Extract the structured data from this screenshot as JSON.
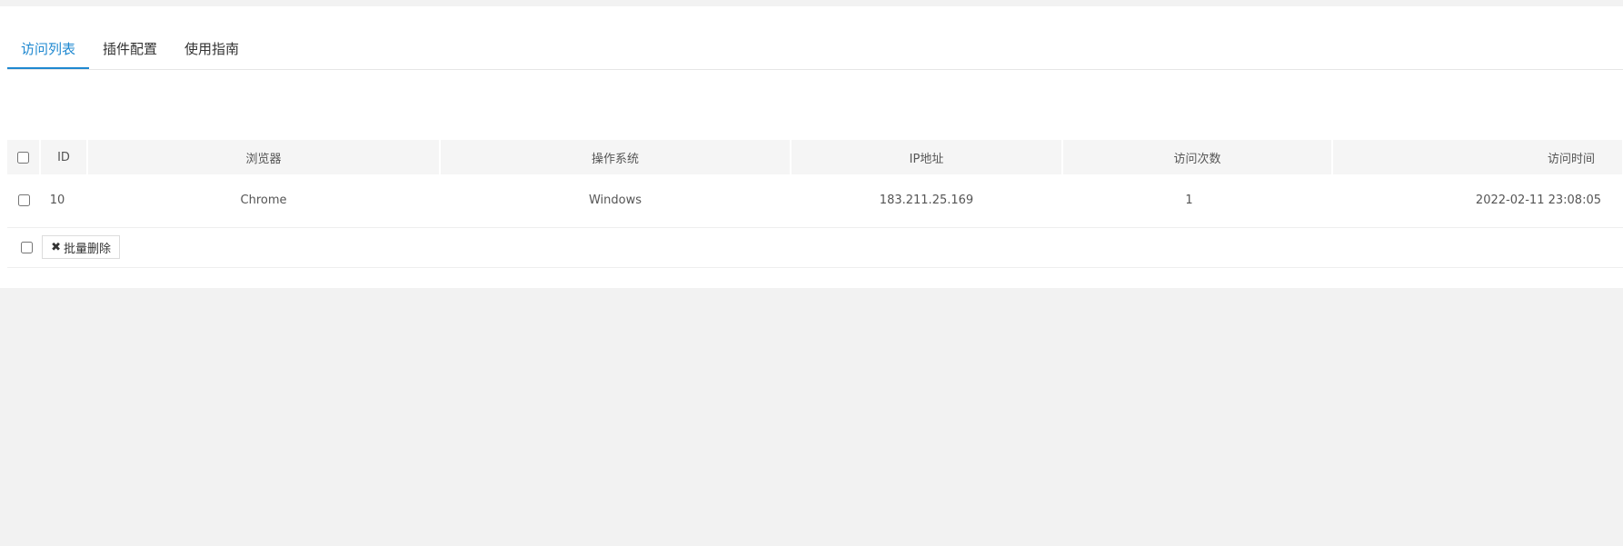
{
  "tabs": [
    {
      "label": "访问列表",
      "active": true
    },
    {
      "label": "插件配置",
      "active": false
    },
    {
      "label": "使用指南",
      "active": false
    }
  ],
  "table": {
    "columns": [
      "ID",
      "浏览器",
      "操作系统",
      "IP地址",
      "访问次数",
      "访问时间"
    ],
    "rows": [
      {
        "id": "10",
        "browser": "Chrome",
        "os": "Windows",
        "ip": "183.211.25.169",
        "visits": "1",
        "time": "2022-02-11 23:08:05"
      }
    ]
  },
  "actions": {
    "batch_delete_icon": "✖",
    "batch_delete_label": "批量删除"
  },
  "colors": {
    "accent": "#1e88d0",
    "header_bg": "#f5f5f5",
    "page_bg": "#f2f2f2"
  }
}
